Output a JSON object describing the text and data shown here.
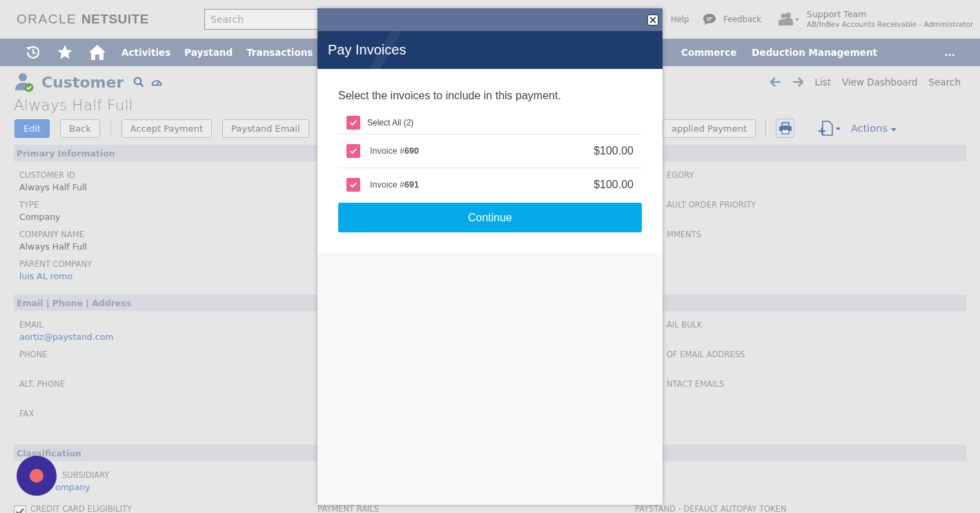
{
  "header": {
    "logo_left": "ORACLE",
    "logo_right": "NETSUITE",
    "search": {
      "placeholder": "Search"
    },
    "links": [
      "Help",
      "Feedback"
    ],
    "user": {
      "name": "Support Team",
      "role": "AB/InBev Accounts Receivable - Administrator"
    }
  },
  "nav": {
    "items": [
      "Activities",
      "Paystand",
      "Transactions"
    ],
    "items_right": [
      "Commerce",
      "Deduction Management"
    ],
    "more": "..."
  },
  "record": {
    "type": "Customer",
    "name": "Always Half Full",
    "links": [
      "List",
      "View Dashboard",
      "Search"
    ]
  },
  "buttons": [
    {
      "label": "Edit",
      "kind": "primary"
    },
    {
      "label": "Back",
      "kind": "default"
    },
    {
      "label": "Accept Payment",
      "kind": "default"
    },
    {
      "label": "Paystand Email",
      "kind": "default"
    }
  ],
  "buttons_right": [
    {
      "label": "applied Payment"
    }
  ],
  "actions": "Actions",
  "sections": [
    {
      "title": "Primary Information",
      "left": [
        {
          "label": "CUSTOMER ID",
          "value": "Always Half Full",
          "link": false
        },
        {
          "label": "TYPE",
          "value": "Company",
          "link": false
        },
        {
          "label": "COMPANY NAME",
          "value": "Always Half Full",
          "link": false
        },
        {
          "label": "PARENT COMPANY",
          "value": "luis AL romo",
          "link": true
        }
      ],
      "right": [
        "EGORY",
        "AULT ORDER PRIORITY",
        "MMENTS"
      ]
    },
    {
      "title": "Email | Phone | Address",
      "left": [
        {
          "label": "EMAIL",
          "value": "aortiz@paystand.com",
          "link": true
        },
        {
          "label": "PHONE"
        },
        {
          "label": "ALT. PHONE"
        },
        {
          "label": "FAX"
        }
      ],
      "right": [
        "AIL BULK",
        "OF EMAIL ADDRESS",
        "NTACT EMAILS"
      ]
    },
    {
      "title": "Classification",
      "left": [
        {
          "label": "SUBSIDIARY",
          "value": "ompany",
          "link": true
        }
      ]
    }
  ],
  "bottom_row": [
    {
      "kind": "checkbox",
      "label": "CREDIT CARD ELIGIBILITY",
      "checked": true
    },
    {
      "kind": "label",
      "label": "PAYMENT RAILS"
    },
    {
      "kind": "label",
      "label": "PAYSTAND - DEFAULT AUTOPAY TOKEN"
    }
  ],
  "modal": {
    "title": "Pay Invoices",
    "instruction": "Select the invoices to include in this payment.",
    "select_all": {
      "label": "Select All (2)",
      "checked": true
    },
    "invoices": [
      {
        "label": "Invoice #**690**",
        "amount": "$100.00",
        "checked": true
      },
      {
        "label": "Invoice #**691**",
        "amount": "$100.00",
        "checked": true
      }
    ],
    "button": "Continue"
  }
}
